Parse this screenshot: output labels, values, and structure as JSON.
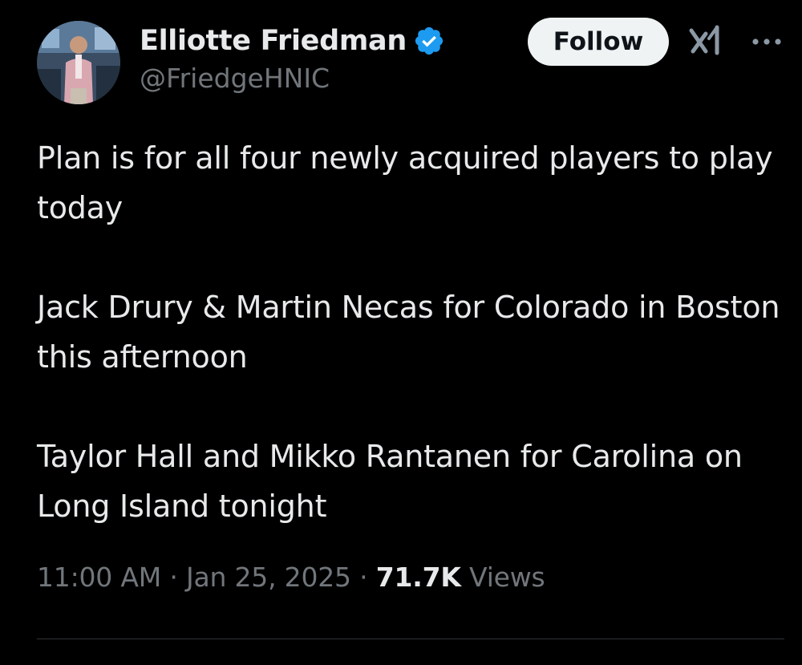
{
  "author": {
    "display_name": "Elliotte Friedman",
    "handle": "@FriedgeHNIC",
    "verified": true,
    "verified_color": "#1d9bf0"
  },
  "actions": {
    "follow_label": "Follow",
    "grok_icon": "grok-icon",
    "more_icon": "more-icon"
  },
  "tweet": {
    "paragraphs": [
      "Plan is for all four newly acquired players to play today",
      "Jack Drury & Martin Necas for Colorado in Boston this afternoon",
      "Taylor Hall and Mikko Rantanen for Carolina on Long Island tonight"
    ]
  },
  "meta": {
    "time": "11:00 AM",
    "separator": "·",
    "date": "Jan 25, 2025",
    "views_count": "71.7K",
    "views_label": "Views"
  },
  "colors": {
    "background": "#000000",
    "text": "#e7e9ea",
    "secondary_text": "#71767b",
    "button_bg": "#eff3f4",
    "divider": "#2f3336"
  }
}
